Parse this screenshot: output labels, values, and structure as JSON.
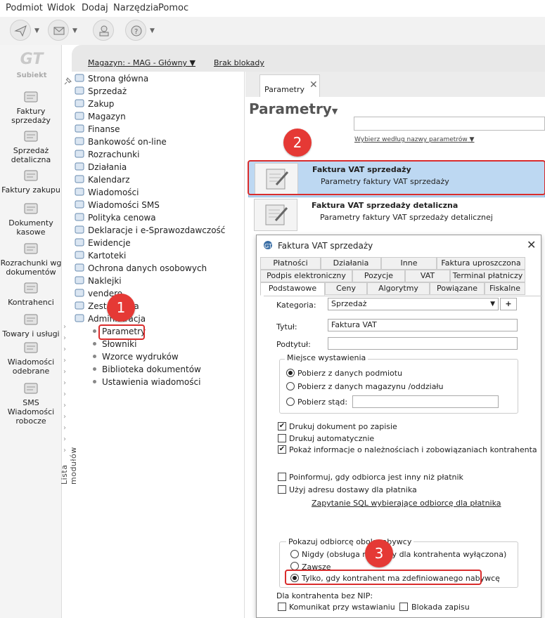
{
  "menu": [
    "Podmiot",
    "Widok",
    "Dodaj",
    "Narzędzia",
    "Pomoc"
  ],
  "toolbar": {
    "icons": [
      "send-icon",
      "mail-icon",
      "user-hat-icon",
      "help-icon"
    ]
  },
  "app": {
    "logo_text": "GT",
    "logo_sub": "Subiekt"
  },
  "modules": [
    {
      "label": "Faktury sprzedaży",
      "icon": "invoice-icon"
    },
    {
      "label": "Sprzedaż detaliczna",
      "icon": "retail-icon"
    },
    {
      "label": "Faktury zakupu",
      "icon": "purchase-icon"
    },
    {
      "label": "Dokumenty kasowe",
      "icon": "cash-icon"
    },
    {
      "label": "Rozrachunki wg dokumentów",
      "icon": "settlement-icon"
    },
    {
      "label": "Kontrahenci",
      "icon": "contractor-icon"
    },
    {
      "label": "Towary i usługi",
      "icon": "goods-icon"
    },
    {
      "label": "Wiadomości odebrane",
      "icon": "inbox-icon"
    },
    {
      "label": "SMS Wiadomości robocze",
      "icon": "sms-icon"
    }
  ],
  "subheader": {
    "warehouse": "Magazyn: - MAG - Główny",
    "lock": "Brak blokady"
  },
  "tree": {
    "items": [
      "Strona główna",
      "Sprzedaż",
      "Zakup",
      "Magazyn",
      "Finanse",
      "Bankowość on-line",
      "Rozrachunki",
      "Działania",
      "Kalendarz",
      "Wiadomości",
      "Wiadomości SMS",
      "Polityka cenowa",
      "Deklaracje i e-Sprawozdawczość",
      "Ewidencje",
      "Kartoteki",
      "Ochrona danych osobowych",
      "Naklejki",
      "vendero",
      "Zestawienia",
      "Administracja"
    ],
    "subitems": [
      "Parametry",
      "Słowniki",
      "Wzorce wydruków",
      "Biblioteka dokumentów",
      "Ustawienia wiadomości"
    ],
    "vertical_label": "Lista modułów"
  },
  "badges": [
    "1",
    "2",
    "3"
  ],
  "main": {
    "tab_label": "Parametry",
    "tab_close": "✕",
    "title": "Parametry",
    "choose_link": "Wybierz według nazwy parametrów",
    "cards": [
      {
        "title": "Faktura VAT sprzedaży",
        "subtitle": "Parametry faktury VAT sprzedaży"
      },
      {
        "title": "Faktura VAT sprzedaży detaliczna",
        "subtitle": "Parametry faktury VAT sprzedaży detalicznej"
      }
    ]
  },
  "dialog": {
    "title": "Faktura VAT sprzedaży",
    "close": "✕",
    "tabs_row1": [
      "Płatności",
      "Działania",
      "Inne",
      "Faktura uproszczona"
    ],
    "tabs_row2": [
      "Podpis elektroniczny",
      "Pozycje",
      "VAT",
      "Terminal płatniczy"
    ],
    "tabs_row3": [
      "Podstawowe",
      "Ceny",
      "Algorytmy",
      "Powiązane",
      "Fiskalne"
    ],
    "kategoria_label": "Kategoria:",
    "kategoria_value": "Sprzedaż",
    "plus": "+",
    "tytul_label": "Tytuł:",
    "tytul_value": "Faktura VAT",
    "podtytul_label": "Podtytuł:",
    "podtytul_value": "",
    "miejsce_title": "Miejsce wystawienia",
    "miejsce_opts": [
      "Pobierz z danych podmiotu",
      "Pobierz z danych magazynu /oddziału",
      "Pobierz stąd:"
    ],
    "checks1": [
      {
        "label": "Drukuj dokument po zapisie",
        "checked": true
      },
      {
        "label": "Drukuj automatycznie",
        "checked": false
      },
      {
        "label": "Pokaż informacje o należnościach i zobowiązaniach kontrahenta",
        "checked": true
      }
    ],
    "checks2": [
      {
        "label": "Poinformuj, gdy odbiorca jest inny niż płatnik",
        "checked": false
      },
      {
        "label": "Użyj adresu dostawy dla płatnika",
        "checked": false
      }
    ],
    "sql_link": "Zapytanie SQL wybierające odbiorcę dla płatnika",
    "nabywca_title": "Pokazuj odbiorcę obok nabywcy",
    "nabywca_opts": [
      "Nigdy (obsługa nabywcy dla kontrahenta wyłączona)",
      "Zawsze",
      "Tylko, gdy kontrahent ma zdefiniowanego nabywcę"
    ],
    "nip_label": "Dla kontrahenta bez NIP:",
    "nip_checks": [
      "Komunikat przy wstawianiu",
      "Blokada zapisu"
    ]
  },
  "colors": {
    "highlight": "#d92c2c",
    "badge": "#e53935",
    "selected_card": "#bdd8f2"
  }
}
